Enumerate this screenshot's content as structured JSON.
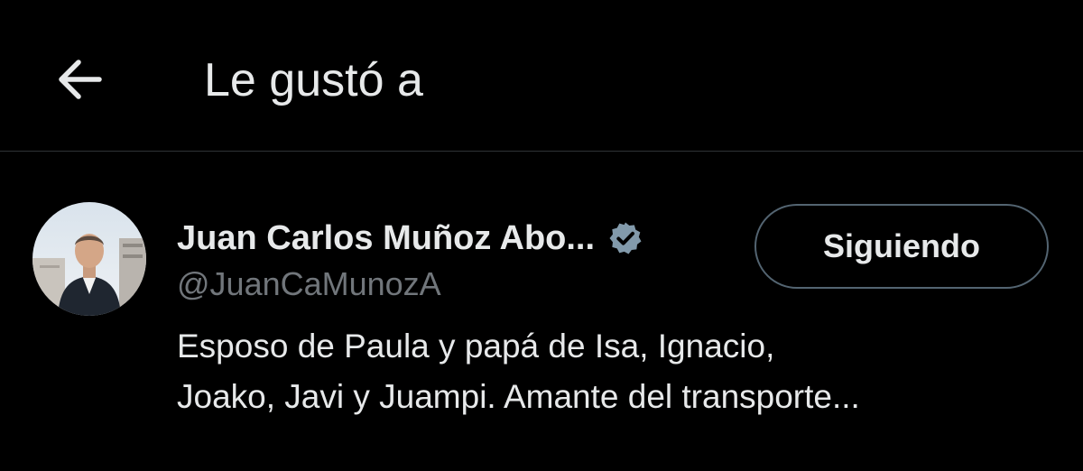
{
  "header": {
    "back_icon": "arrow-left-icon",
    "title": "Le gustó a"
  },
  "user": {
    "avatar_icon": "avatar-photo",
    "display_name": "Juan Carlos Muñoz Abo...",
    "verified_icon": "verified-badge-icon",
    "handle": "@JuanCaMunozA",
    "follow_button_label": "Siguiendo",
    "bio_lines": [
      "Esposo de Paula y papá de Isa, Ignacio,",
      "Joako, Javi y Juampi. Amante del transporte..."
    ]
  },
  "colors": {
    "background": "#000000",
    "text_primary": "#e7e9ea",
    "text_secondary": "#71767b",
    "divider": "#2f3336",
    "button_border": "#536471",
    "verified": "#829aab"
  }
}
